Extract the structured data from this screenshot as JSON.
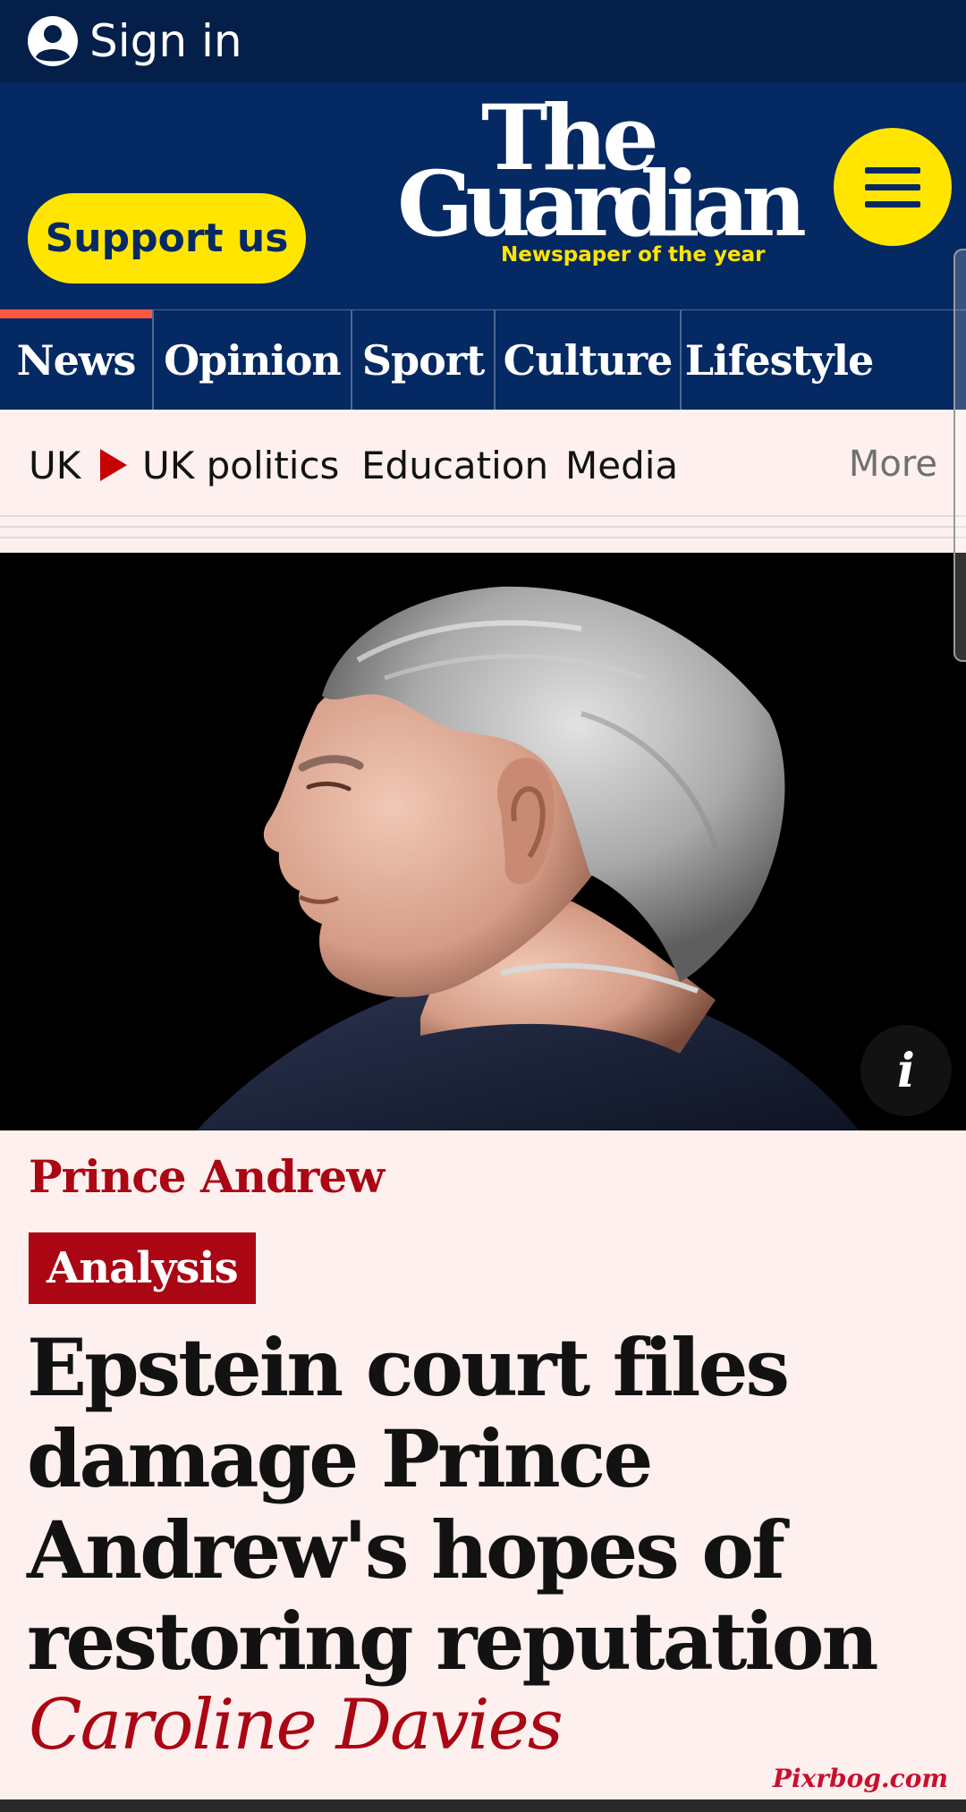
{
  "topbar": {
    "sign_in_label": "Sign in"
  },
  "masthead": {
    "support_label": "Support us",
    "logo_line1": "The",
    "logo_line2": "Guardian",
    "tagline": "Newspaper of the year",
    "menu_icon": "hamburger-icon"
  },
  "pillars": [
    {
      "label": "News",
      "active": true
    },
    {
      "label": "Opinion",
      "active": false
    },
    {
      "label": "Sport",
      "active": false
    },
    {
      "label": "Culture",
      "active": false
    },
    {
      "label": "Lifestyle",
      "active": false
    }
  ],
  "subnav": {
    "items": [
      "UK",
      "UK politics",
      "Education",
      "Media"
    ],
    "more_label": "More"
  },
  "hero": {
    "info_label": "i"
  },
  "article": {
    "kicker": "Prince Andrew",
    "badge": "Analysis",
    "headline": "Epstein court files damage Prince Andrew's hopes of restoring reputation",
    "byline": "Caroline Davies"
  },
  "watermark": "Pixrbog.com",
  "colors": {
    "brand_navy": "#052962",
    "top_navy": "#041f4a",
    "brand_yellow": "#ffe500",
    "news_red": "#ab0613",
    "background": "#fdf0ef"
  }
}
